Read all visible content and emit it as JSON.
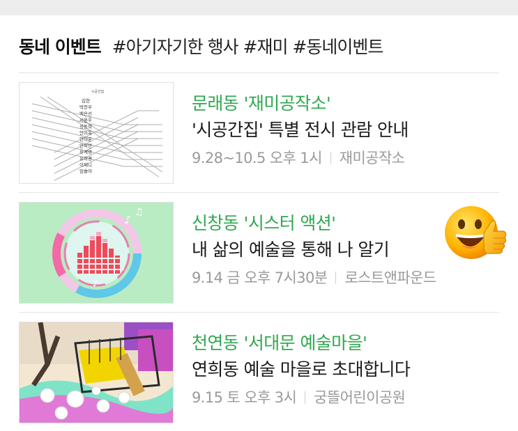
{
  "header": {
    "title": "동네 이벤트",
    "tags": "#아기자기한 행사 #재미 #동네이벤트"
  },
  "events": [
    {
      "title": "문래동 '재미공작소'",
      "description": "'시공간집' 특별 전시 관람 안내",
      "date": "9.28~10.5 오후 1시",
      "place": "재미공작소",
      "thumb_names": [
        "김현",
        "박찬우",
        "백은선",
        "서윤후",
        "성동혁",
        "안미옥",
        "안태운",
        "안희연",
        "유계영",
        "유희경",
        "이제니",
        "임솔아"
      ]
    },
    {
      "title": "신창동 '시스터 액션'",
      "description": "내 삶의 예술을 통해 나 알기",
      "date": "9.14 금 오후 7시30분",
      "place": "로스트앤파운드"
    },
    {
      "title": "천연동 '서대문 예술마을'",
      "description": "연희동 예술 마을로 초대합니다",
      "date": "9.15 토 오후 3시",
      "place": "궁뜰어린이공원"
    }
  ],
  "sticker": {
    "icon": "thumbs-up-smiley-icon"
  },
  "colors": {
    "title_green": "#2fa84f",
    "meta_gray": "#9a9a9a"
  }
}
